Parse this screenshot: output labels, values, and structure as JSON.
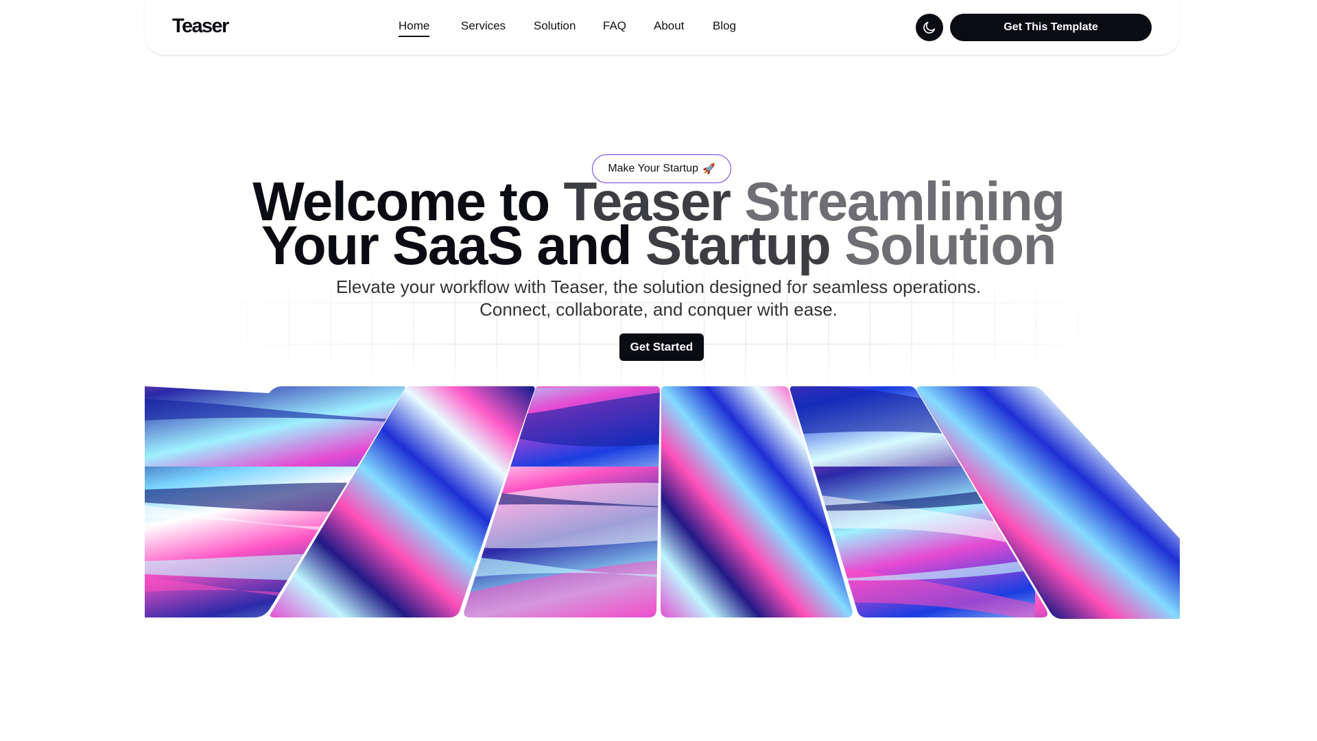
{
  "header": {
    "logo": "Teaser",
    "nav": [
      "Home",
      "Services",
      "Solution",
      "FAQ",
      "About",
      "Blog"
    ],
    "active_nav": "Home",
    "theme_toggle_icon": "moon-icon",
    "cta_label": "Get This Template"
  },
  "hero": {
    "badge_text": "Make Your Startup",
    "badge_icon": "rocket-icon",
    "title_line1_a": "Welcome to ",
    "title_line1_b": "Teaser ",
    "title_line1_c": "Streamlining",
    "title_line2_a": "Your SaaS and ",
    "title_line2_b": "Startup ",
    "title_line2_c": "Solution",
    "subtitle_line1": "Elevate your workflow with Teaser, the solution designed for seamless operations.",
    "subtitle_line2": "Connect, collaborate, and conquer with ease.",
    "cta_label": "Get Started"
  },
  "colors": {
    "brand_dark": "#0b0b14",
    "badge_border": "#6c3ce9",
    "title_dark": "#0b0b14",
    "title_mid": "#3d3d44",
    "title_light": "#6e6e74"
  }
}
